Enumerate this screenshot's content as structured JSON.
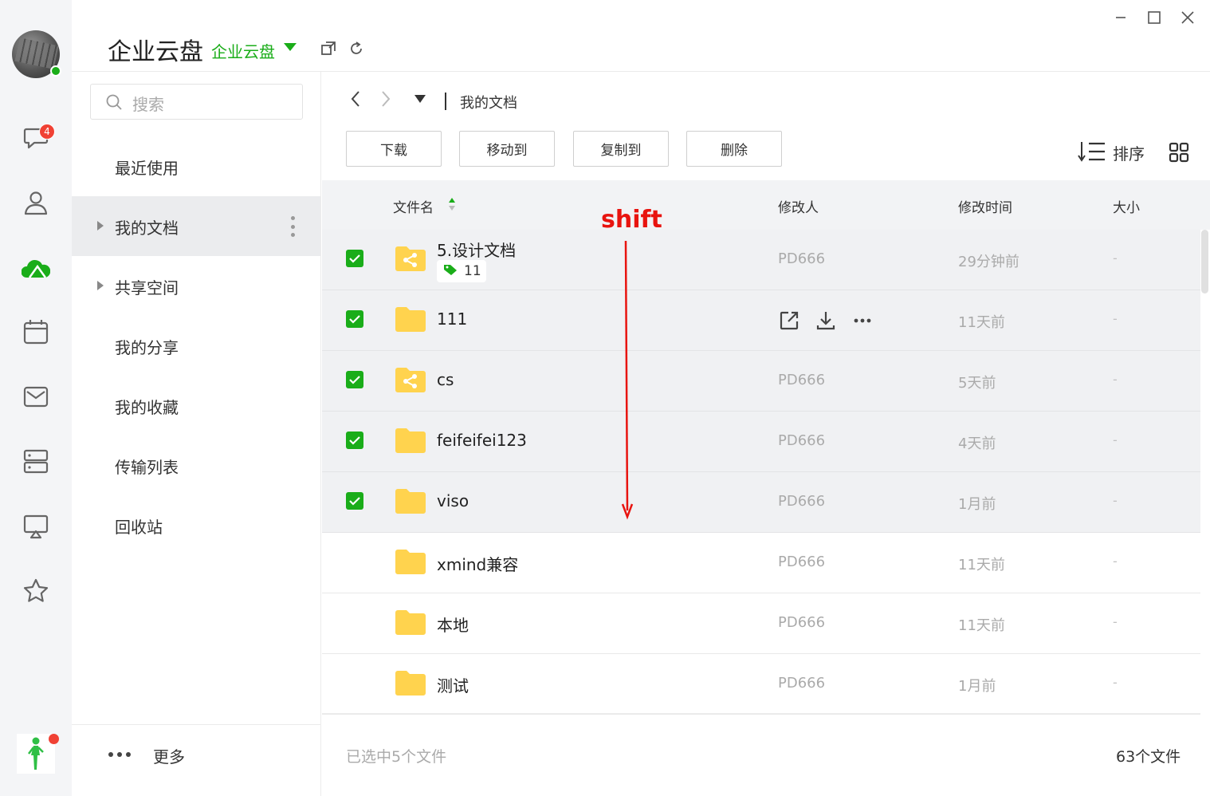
{
  "app": {
    "title": "企业云盘",
    "space_selector": "企业云盘"
  },
  "rail": {
    "chat_badge": "4",
    "icons": [
      "chat-icon",
      "contacts-icon",
      "cloud-disk-icon",
      "calendar-icon",
      "mail-icon",
      "server-icon",
      "screen-share-icon",
      "star-icon"
    ],
    "accent": "#1aad19"
  },
  "sidebar": {
    "search_placeholder": "搜索",
    "items": [
      {
        "label": "最近使用"
      },
      {
        "label": "我的文档"
      },
      {
        "label": "共享空间"
      },
      {
        "label": "我的分享"
      },
      {
        "label": "我的收藏"
      },
      {
        "label": "传输列表"
      },
      {
        "label": "回收站"
      }
    ],
    "more_label": "更多"
  },
  "breadcrumb": {
    "current": "我的文档"
  },
  "toolbar": {
    "download": "下载",
    "move_to": "移动到",
    "copy_to": "复制到",
    "delete": "删除",
    "sort": "排序"
  },
  "table": {
    "columns": {
      "name": "文件名",
      "modifier": "修改人",
      "modified_time": "修改时间",
      "size": "大小"
    },
    "rows": [
      {
        "name": "5.设计文档",
        "tag_count": "11",
        "modifier": "PD666",
        "time": "29分钟前",
        "size": "-",
        "selected": true,
        "shared": true
      },
      {
        "name": "111",
        "modifier": "",
        "time": "11天前",
        "size": "-",
        "selected": true,
        "shared": false,
        "hovered": true
      },
      {
        "name": "cs",
        "modifier": "PD666",
        "time": "5天前",
        "size": "-",
        "selected": true,
        "shared": true
      },
      {
        "name": "feifeifei123",
        "modifier": "PD666",
        "time": "4天前",
        "size": "-",
        "selected": true,
        "shared": false
      },
      {
        "name": "viso",
        "modifier": "PD666",
        "time": "1月前",
        "size": "-",
        "selected": true,
        "shared": false
      },
      {
        "name": "xmind兼容",
        "modifier": "PD666",
        "time": "11天前",
        "size": "-",
        "selected": false,
        "shared": false
      },
      {
        "name": "本地",
        "modifier": "PD666",
        "time": "11天前",
        "size": "-",
        "selected": false,
        "shared": false
      },
      {
        "name": "测试",
        "modifier": "PD666",
        "time": "1月前",
        "size": "-",
        "selected": false,
        "shared": false
      }
    ]
  },
  "annotation": {
    "label": "shift",
    "color": "#e8140f"
  },
  "footer": {
    "selected_text": "已选中5个文件",
    "total_text": "63个文件"
  }
}
